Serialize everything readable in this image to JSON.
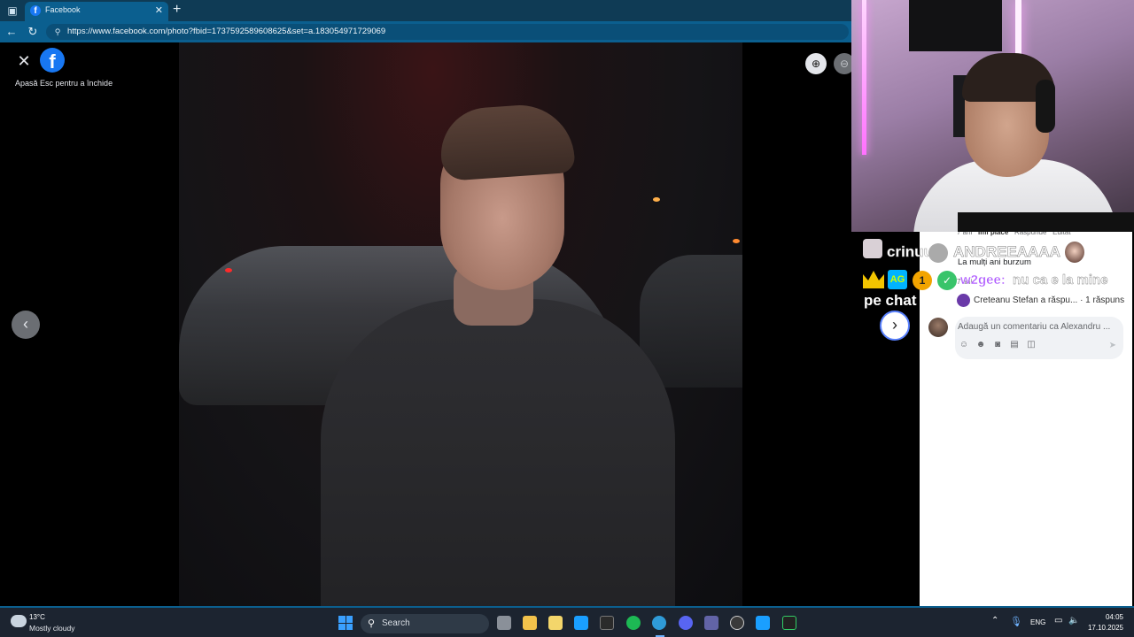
{
  "browser": {
    "tab_title": "Facebook",
    "url": "https://www.facebook.com/photo?fbid=1737592589608625&set=a.183054971729069"
  },
  "viewer": {
    "esc_hint": "Apasă Esc pentru a închide",
    "facebook_logo": "f"
  },
  "comments": {
    "meta_time": "7 ani",
    "meta_like": "Îmi place",
    "meta_reply": "Răspunde",
    "meta_edited": "Editat",
    "text": "La mulți ani burzum",
    "age": "7 ani",
    "reply_summary": "Creteanu Stefan a răspu... · 1 răspuns",
    "composer_placeholder": "Adaugă un comentariu ca Alexandru ..."
  },
  "chat_overlay": {
    "user1": "crinuuk:",
    "msg1": "ANDREEAAAA",
    "badge2": "AG",
    "badge3": "1",
    "badge4": "✓",
    "user2": "w2gee:",
    "msg2": "nu ca e la mine",
    "line3": "pe chat"
  },
  "taskbar": {
    "weather_temp": "13°C",
    "weather_desc": "Mostly cloudy",
    "search_placeholder": "Search",
    "language": "ENG",
    "time": "04:05",
    "date": "17.10.2025"
  },
  "colors": {
    "facebook_blue": "#1877f2",
    "browser_chrome": "#0b5f8f",
    "taskbar": "#1c2430"
  },
  "icons": {
    "tab_toggle": "sidebar-icon",
    "back": "arrow-left-icon",
    "reload": "reload-icon",
    "zoom_in": "magnifier-plus-icon",
    "zoom_out": "magnifier-minus-icon",
    "prev": "chevron-left-icon",
    "next": "chevron-right-icon"
  }
}
